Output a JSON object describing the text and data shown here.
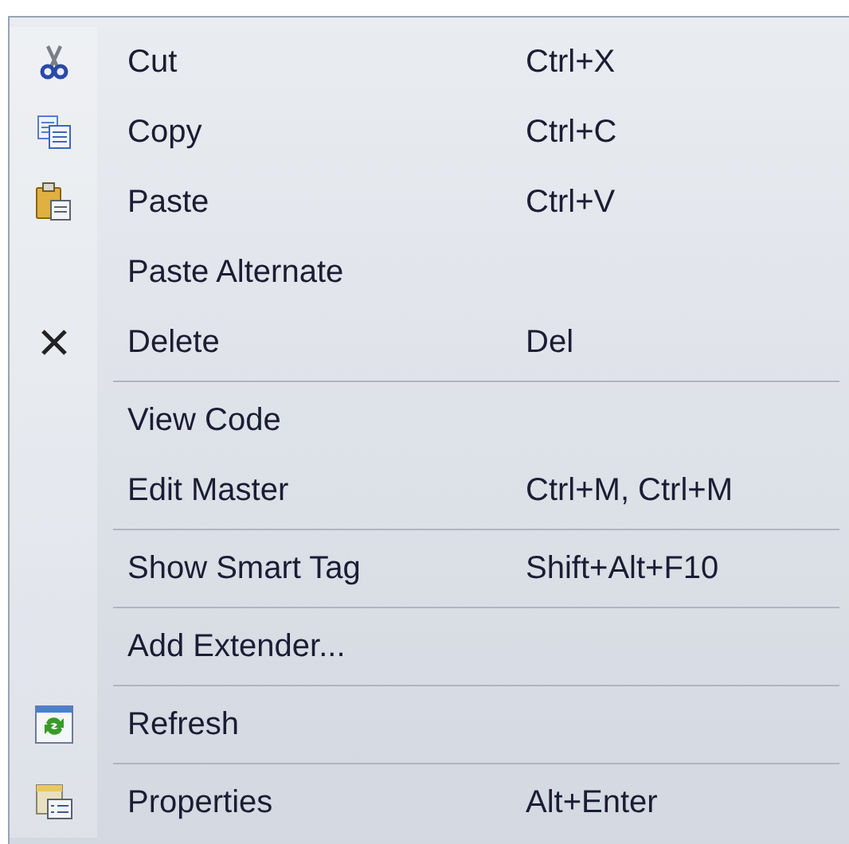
{
  "menu": {
    "items": [
      {
        "kind": "scissors",
        "label": "Cut",
        "shortcut": "Ctrl+X"
      },
      {
        "kind": "copy",
        "label": "Copy",
        "shortcut": "Ctrl+C"
      },
      {
        "kind": "paste",
        "label": "Paste",
        "shortcut": "Ctrl+V"
      },
      {
        "kind": "plain",
        "label": "Paste Alternate"
      },
      {
        "kind": "cross",
        "label": "Delete",
        "shortcut": "Del"
      },
      {
        "kind": "separator"
      },
      {
        "kind": "plain",
        "label": "View Code"
      },
      {
        "kind": "plain",
        "label": "Edit Master",
        "shortcut": "Ctrl+M, Ctrl+M"
      },
      {
        "kind": "separator"
      },
      {
        "kind": "plain",
        "label": "Show Smart Tag",
        "shortcut": "Shift+Alt+F10"
      },
      {
        "kind": "separator"
      },
      {
        "kind": "plain",
        "label": "Add Extender..."
      },
      {
        "kind": "separator"
      },
      {
        "kind": "refresh",
        "label": "Refresh"
      },
      {
        "kind": "separator"
      },
      {
        "kind": "properties",
        "label": "Properties",
        "shortcut": "Alt+Enter"
      }
    ]
  }
}
